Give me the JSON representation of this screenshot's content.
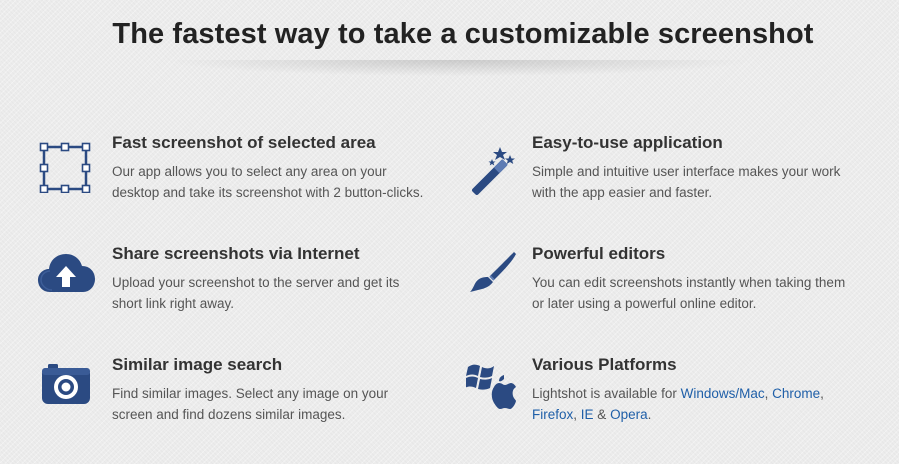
{
  "headline": "The fastest way to take a customizable screenshot",
  "colors": {
    "icon": "#2b4a82",
    "icon_dark": "#1c3366",
    "link": "#1f5fa8",
    "heading": "#333333",
    "body": "#555555"
  },
  "features": [
    {
      "icon": "selection-area-icon",
      "title": "Fast screenshot of selected area",
      "line1": "Our app allows you to select any area on your",
      "line2": "desktop and take its screenshot with 2 button-clicks."
    },
    {
      "icon": "magic-wand-icon",
      "title": "Easy-to-use application",
      "line1": "Simple and intuitive user interface makes your work",
      "line2": "with the app easier and faster."
    },
    {
      "icon": "cloud-upload-icon",
      "title": "Share screenshots via Internet",
      "line1": "Upload your screenshot to the server and get its",
      "line2": "short link right away."
    },
    {
      "icon": "paintbrush-icon",
      "title": "Powerful editors",
      "line1": "You can edit screenshots instantly when taking them",
      "line2": "or later using a powerful online editor."
    },
    {
      "icon": "camera-icon",
      "title": "Similar image search",
      "line1": "Find similar images. Select any image on your",
      "line2": "screen and find dozens similar images."
    },
    {
      "icon": "windows-apple-icon",
      "title": "Various Platforms",
      "prefix": "Lightshot is available for ",
      "links": {
        "windows_mac": "Windows/Mac",
        "comma1": ", ",
        "chrome": "Chrome",
        "comma2": ",",
        "firefox": "Firefox",
        "comma3": ", ",
        "ie": "IE",
        "amp": " & ",
        "opera": "Opera",
        "period": "."
      }
    }
  ]
}
